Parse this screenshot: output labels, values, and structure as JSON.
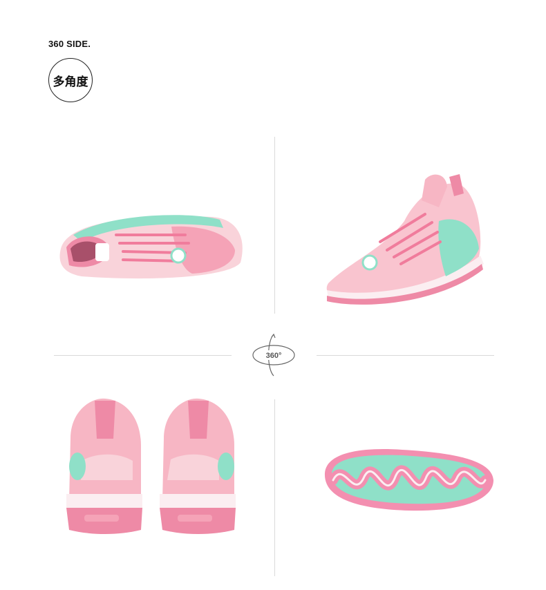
{
  "header": {
    "eyebrow": "360 SIDE.",
    "badge_text": "多角度"
  },
  "rotate_icon": {
    "label": "360°"
  },
  "views": [
    {
      "name": "top-view",
      "icon": "shoe-top-view-image"
    },
    {
      "name": "front-three-quarter-view",
      "icon": "shoe-front-view-image"
    },
    {
      "name": "rear-view",
      "icon": "shoe-rear-view-image"
    },
    {
      "name": "outsole-view",
      "icon": "shoe-outsole-view-image"
    }
  ],
  "colors": {
    "upper_pink": "#f7b6c4",
    "deep_pink": "#ee8aa6",
    "mint": "#8fe0c8",
    "white_sole": "#fbeef1",
    "divider": "#d9d9d9"
  }
}
